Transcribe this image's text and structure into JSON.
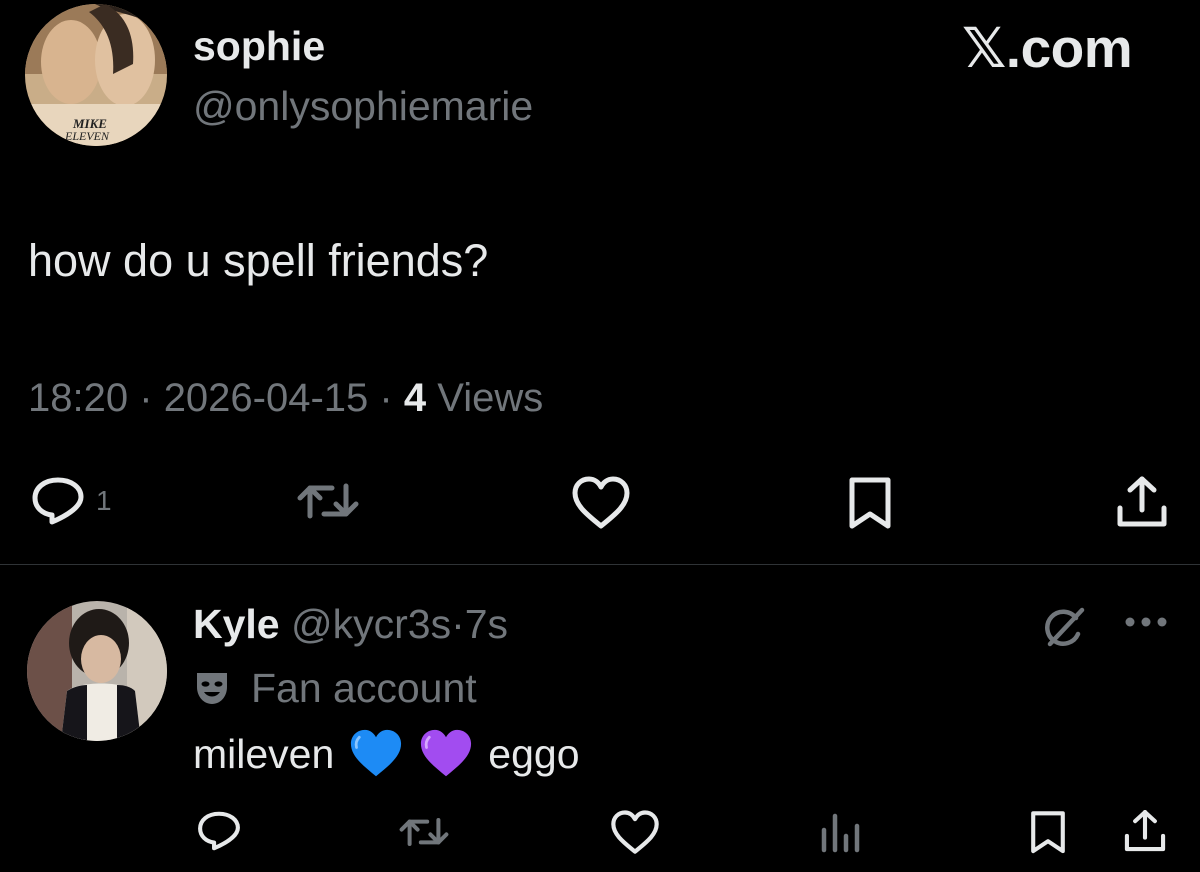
{
  "tweet": {
    "display_name": "sophie",
    "handle": "@onlysophiemarie",
    "avatar_label_1": "MIKE",
    "avatar_label_2": "ELEVEN",
    "brand": "𝕏.com",
    "text": "how do u spell friends?",
    "time": "18:20",
    "sep": "·",
    "date": "2026-04-15",
    "views_count": "4",
    "views_label": "Views",
    "actions": {
      "reply_icon": "reply-icon",
      "reply_count": "1",
      "retweet_icon": "retweet-icon",
      "like_icon": "heart-icon",
      "bookmark_icon": "bookmark-icon",
      "share_icon": "share-icon"
    }
  },
  "reply": {
    "display_name": "Kyle",
    "handle": "@kycr3s",
    "sep": "·",
    "time": "7s",
    "badge_icon": "theater-mask-icon",
    "badge_label": "Fan account",
    "text_before": "mileven",
    "emoji_1": "blue-heart",
    "emoji_2": "purple-heart",
    "text_after": "eggo",
    "header_icons": [
      "grok-icon",
      "more-icon"
    ],
    "actions": [
      "reply-icon",
      "retweet-icon",
      "heart-icon",
      "views-icon",
      "bookmark-icon",
      "share-icon"
    ]
  },
  "colors": {
    "background": "#000000",
    "text_primary": "#e7e9ea",
    "text_secondary": "#71767b",
    "divider": "#2f3336",
    "blue_heart": "#1d8bf5",
    "purple_heart": "#a24cf0"
  }
}
